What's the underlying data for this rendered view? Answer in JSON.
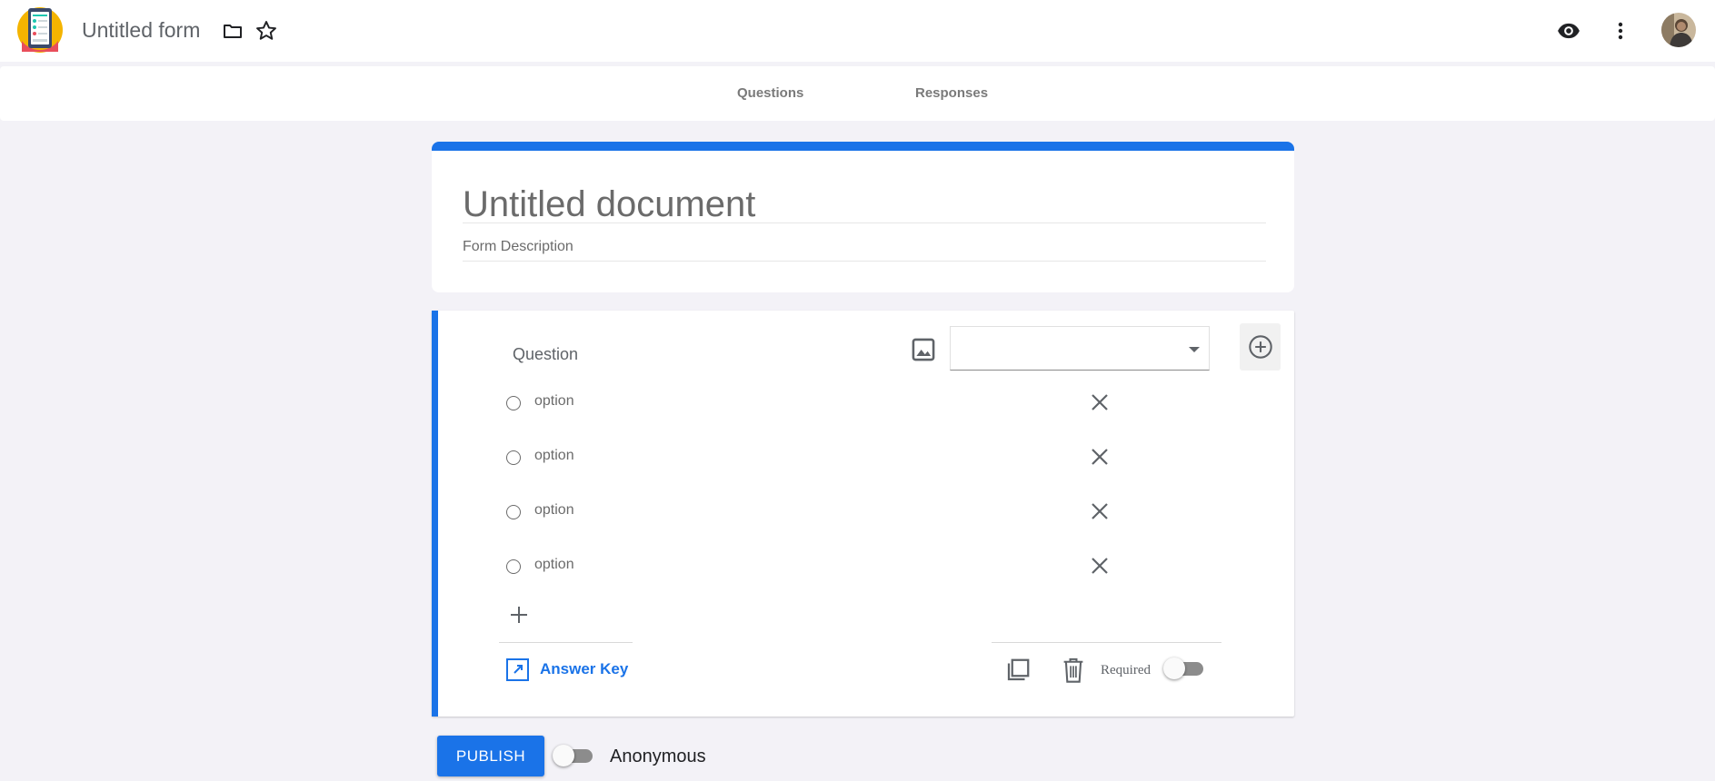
{
  "header": {
    "app_title": "Untitled form",
    "icons": [
      "app-logo-icon",
      "folder-icon",
      "star-icon",
      "eye-icon",
      "more-vert-icon",
      "avatar"
    ]
  },
  "tabs": [
    {
      "label": "Questions"
    },
    {
      "label": "Responses"
    }
  ],
  "form": {
    "title": "Untitled document",
    "description": "Form Description",
    "accent_color": "#1a73e8"
  },
  "question": {
    "label": "Question",
    "type_selected": "",
    "options": [
      {
        "label": "option"
      },
      {
        "label": "option"
      },
      {
        "label": "option"
      },
      {
        "label": "option"
      }
    ],
    "answer_key_label": "Answer Key",
    "required_label": "Required",
    "required": false
  },
  "footer": {
    "publish_label": "PUBLISH",
    "anonymous_label": "Anonymous",
    "anonymous": false
  }
}
